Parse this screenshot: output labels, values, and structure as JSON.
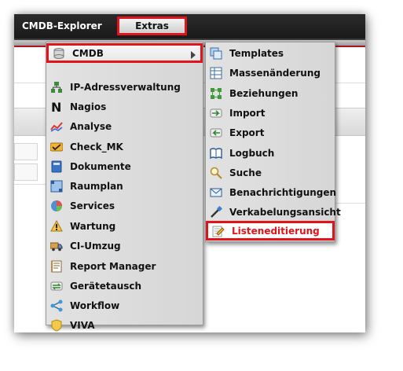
{
  "topbar": {
    "brand": "CMDB-Explorer",
    "extras_label": "Extras"
  },
  "colors": {
    "highlight": "#e1131b",
    "topbar": "#1f1f1f",
    "menu_bg": "#dcdcdc"
  },
  "menu": {
    "items": [
      {
        "label": "CMDB",
        "icon": "cmdb-icon",
        "has_submenu": true,
        "selected": true
      },
      {
        "label": "IP-Adressverwaltung",
        "icon": "ip-network-icon"
      },
      {
        "label": "Nagios",
        "icon": "nagios-icon"
      },
      {
        "label": "Analyse",
        "icon": "analysis-icon"
      },
      {
        "label": "Check_MK",
        "icon": "checkmk-icon"
      },
      {
        "label": "Dokumente",
        "icon": "document-icon"
      },
      {
        "label": "Raumplan",
        "icon": "floorplan-icon"
      },
      {
        "label": "Services",
        "icon": "services-pie-icon"
      },
      {
        "label": "Wartung",
        "icon": "maintenance-icon"
      },
      {
        "label": "CI-Umzug",
        "icon": "truck-icon"
      },
      {
        "label": "Report Manager",
        "icon": "report-icon"
      },
      {
        "label": "Gerätetausch",
        "icon": "swap-icon"
      },
      {
        "label": "Workflow",
        "icon": "workflow-icon"
      },
      {
        "label": "VIVA",
        "icon": "shield-icon"
      }
    ]
  },
  "submenu": {
    "items": [
      {
        "label": "Templates",
        "icon": "templates-icon"
      },
      {
        "label": "Massenänderung",
        "icon": "bulk-change-icon"
      },
      {
        "label": "Beziehungen",
        "icon": "relations-icon"
      },
      {
        "label": "Import",
        "icon": "import-icon"
      },
      {
        "label": "Export",
        "icon": "export-icon"
      },
      {
        "label": "Logbuch",
        "icon": "logbook-icon"
      },
      {
        "label": "Suche",
        "icon": "search-icon"
      },
      {
        "label": "Benachrichtigungen",
        "icon": "envelope-icon"
      },
      {
        "label": "Verkabelungsansicht",
        "icon": "cable-icon"
      },
      {
        "label": "Listeneditierung",
        "icon": "list-edit-icon",
        "selected": true
      }
    ]
  }
}
